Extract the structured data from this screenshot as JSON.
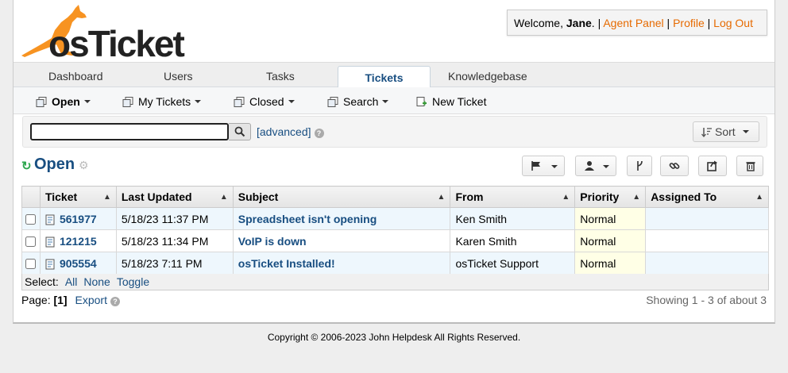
{
  "header": {
    "logo_text_os": "os",
    "logo_text_ticket": "Ticket",
    "welcome_prefix": "Welcome, ",
    "user_name": "Jane",
    "welcome_suffix": ". | ",
    "agent_panel": "Agent Panel",
    "profile": "Profile",
    "logout": "Log Out",
    "sep": " | "
  },
  "nav": {
    "tabs": [
      {
        "label": "Dashboard"
      },
      {
        "label": "Users"
      },
      {
        "label": "Tasks"
      },
      {
        "label": "Tickets",
        "active": true
      },
      {
        "label": "Knowledgebase"
      }
    ]
  },
  "subnav": {
    "items": [
      {
        "label": "Open",
        "bold": true,
        "icon": "tickets-icon"
      },
      {
        "label": "My Tickets",
        "icon": "tickets-icon"
      },
      {
        "label": "Closed",
        "icon": "tickets-icon"
      },
      {
        "label": "Search",
        "icon": "tickets-icon"
      },
      {
        "label": "New Ticket",
        "icon": "new-ticket-icon"
      }
    ]
  },
  "search": {
    "value": "",
    "advanced_label": "[advanced]",
    "sort_label": "Sort"
  },
  "page": {
    "title": "Open"
  },
  "table": {
    "columns": [
      "Ticket",
      "Last Updated",
      "Subject",
      "From",
      "Priority",
      "Assigned To"
    ],
    "rows": [
      {
        "number": "561977",
        "updated": "5/18/23 11:37 PM",
        "subject": "Spreadsheet isn't opening",
        "from": "Ken Smith",
        "priority": "Normal",
        "assigned": ""
      },
      {
        "number": "121215",
        "updated": "5/18/23 11:34 PM",
        "subject": "VoIP is down",
        "from": "Karen Smith",
        "priority": "Normal",
        "assigned": ""
      },
      {
        "number": "905554",
        "updated": "5/18/23 7:11 PM",
        "subject": "osTicket Installed!",
        "from": "osTicket Support",
        "priority": "Normal",
        "assigned": ""
      }
    ]
  },
  "select": {
    "label": "Select:",
    "all": "All",
    "none": "None",
    "toggle": "Toggle"
  },
  "pagination": {
    "label": "Page:",
    "current": "[1]",
    "export": "Export",
    "showing": "Showing 1 - 3 of about 3"
  },
  "footer": {
    "copyright": "Copyright © 2006-2023 John Helpdesk All Rights Reserved."
  },
  "colors": {
    "accent": "#184e81",
    "link_orange": "#e66a00",
    "logo_orange": "#f79321"
  }
}
